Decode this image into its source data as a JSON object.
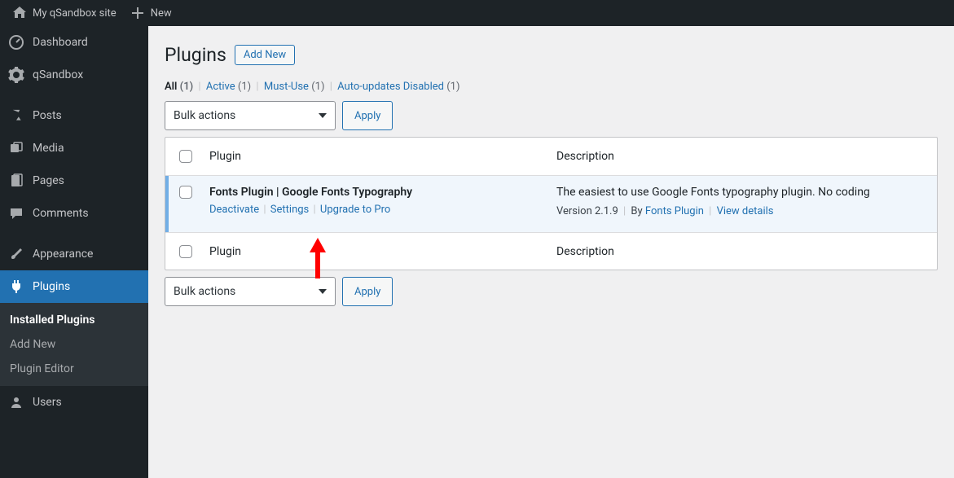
{
  "adminbar": {
    "site_name": "My qSandbox site",
    "new_label": "New"
  },
  "sidebar": {
    "items": [
      {
        "key": "dashboard",
        "label": "Dashboard"
      },
      {
        "key": "qsandbox",
        "label": "qSandbox"
      },
      {
        "key": "posts",
        "label": "Posts"
      },
      {
        "key": "media",
        "label": "Media"
      },
      {
        "key": "pages",
        "label": "Pages"
      },
      {
        "key": "comments",
        "label": "Comments"
      },
      {
        "key": "appearance",
        "label": "Appearance"
      },
      {
        "key": "plugins",
        "label": "Plugins"
      },
      {
        "key": "users",
        "label": "Users"
      }
    ],
    "plugins_submenu": {
      "installed": "Installed Plugins",
      "add_new": "Add New",
      "editor": "Plugin Editor"
    }
  },
  "page": {
    "title": "Plugins",
    "add_new": "Add New"
  },
  "filters": {
    "all_label": "All",
    "all_count": "(1)",
    "active_label": "Active",
    "active_count": "(1)",
    "mustuse_label": "Must-Use",
    "mustuse_count": "(1)",
    "auto_label": "Auto-updates Disabled",
    "auto_count": "(1)"
  },
  "bulk": {
    "select_label": "Bulk actions",
    "apply": "Apply"
  },
  "table": {
    "col_plugin": "Plugin",
    "col_desc": "Description",
    "rows": [
      {
        "name": "Fonts Plugin | Google Fonts Typography",
        "actions": {
          "deactivate": "Deactivate",
          "settings": "Settings",
          "upgrade": "Upgrade to Pro"
        },
        "description": "The easiest to use Google Fonts typography plugin. No coding",
        "version_prefix": "Version 2.1.9",
        "by": "By",
        "author": "Fonts Plugin",
        "view_details": "View details"
      }
    ]
  }
}
